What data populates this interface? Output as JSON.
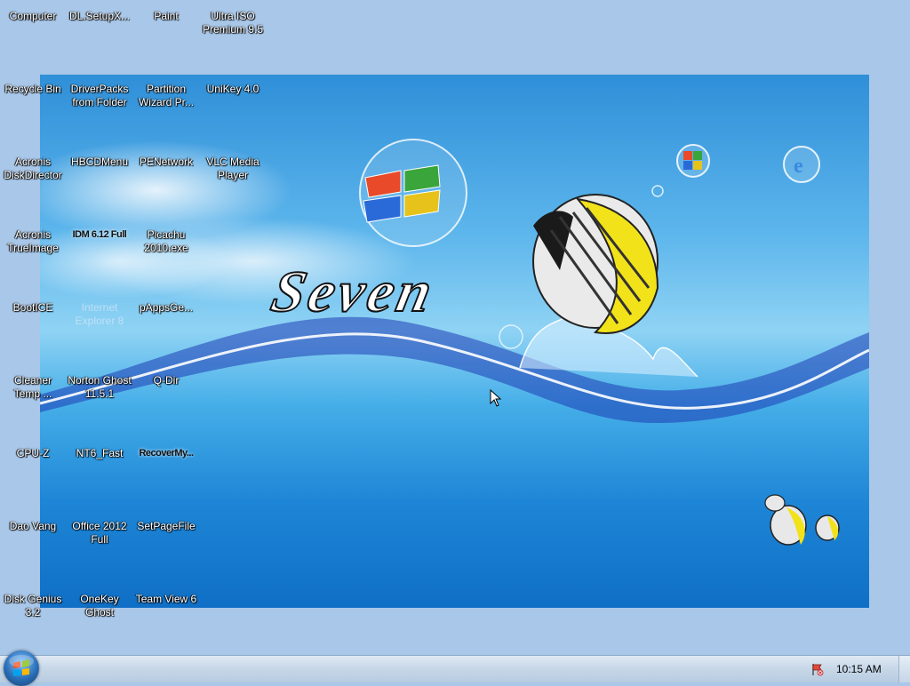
{
  "desktop": {
    "icons": [
      {
        "label": "Computer"
      },
      {
        "label": "DL.SetupX..."
      },
      {
        "label": "Paint"
      },
      {
        "label": "Ultra ISO Premium 9.5"
      },
      {
        "label": "Recycle Bin"
      },
      {
        "label": "DriverPacks from Folder"
      },
      {
        "label": "Partition Wizard Pr..."
      },
      {
        "label": "UniKey 4.0"
      },
      {
        "label": "Acronis DiskDirector"
      },
      {
        "label": "HBCDMenu"
      },
      {
        "label": "PENetwork"
      },
      {
        "label": "VLC Media Player"
      },
      {
        "label": "Acronis TrueImage"
      },
      {
        "label": "IDM 6.12 Full"
      },
      {
        "label": "Picachu 2010.exe"
      },
      {
        "label": "BootICE"
      },
      {
        "label": "Internet Explorer 8"
      },
      {
        "label": "pAppsGe..."
      },
      {
        "label": "Cleaner Temp ..."
      },
      {
        "label": "Norton Ghost 11.5.1"
      },
      {
        "label": "Q-Dir"
      },
      {
        "label": "CPU-Z"
      },
      {
        "label": "NT6_Fast"
      },
      {
        "label": "RecoverMy..."
      },
      {
        "label": "Dao Vang"
      },
      {
        "label": "Office 2012 Full"
      },
      {
        "label": "SetPageFile"
      },
      {
        "label": "Disk Genius 3.2"
      },
      {
        "label": "OneKey Ghost"
      },
      {
        "label": "Team View 6"
      }
    ]
  },
  "wallpaper": {
    "text": "Seven"
  },
  "taskbar": {
    "clock": "10:15 AM",
    "tray_icon": "action-center-flag-icon",
    "start_icon": "windows-start-orb-icon"
  },
  "colors": {
    "desktop_background": "#a9c7e8",
    "taskbar": "#c7d7e8",
    "wallpaper_sky": "#5db6ec",
    "fish_yellow": "#f2e21a"
  }
}
